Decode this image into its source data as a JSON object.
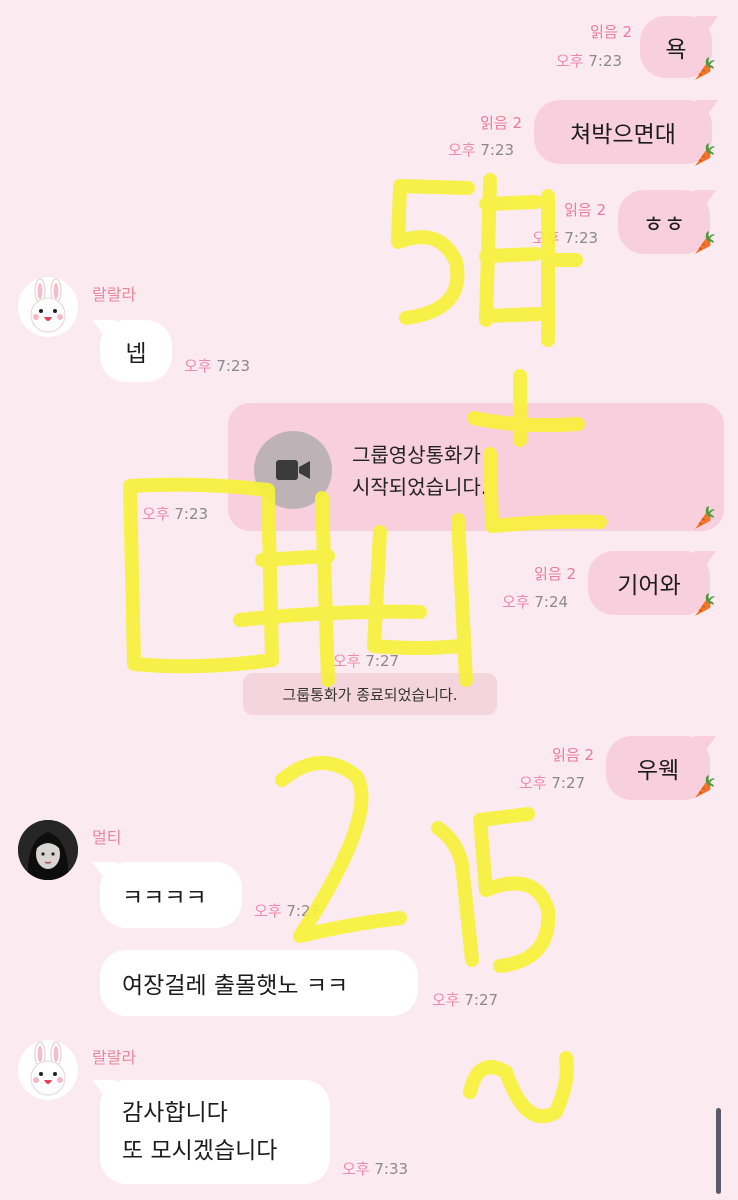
{
  "messages": {
    "m1": {
      "text": "욕",
      "read": "읽음 2",
      "ampm": "오후",
      "time": "7:23"
    },
    "m2": {
      "text": "쳐박으면대",
      "read": "읽음 2",
      "ampm": "오후",
      "time": "7:23"
    },
    "m3": {
      "text": "ㅎㅎ",
      "read": "읽음 2",
      "ampm": "오후",
      "time": "7:23"
    },
    "m4": {
      "sender": "랄랄라",
      "text": "넵",
      "ampm": "오후",
      "time": "7:23"
    },
    "m5": {
      "line1": "그룹영상통화가",
      "line2": "시작되었습니다.",
      "ampm": "오후",
      "time": "7:23"
    },
    "m6": {
      "text": "기어와",
      "read": "읽음 2",
      "ampm": "오후",
      "time": "7:24"
    },
    "m7": {
      "ampm": "오후",
      "time": "7:27",
      "text": "그룹통화가 종료되었습니다."
    },
    "m8": {
      "text": "우웩",
      "read": "읽음 2",
      "ampm": "오후",
      "time": "7:27"
    },
    "m9": {
      "sender": "멀티",
      "text": "ㅋㅋㅋㅋ",
      "ampm": "오후",
      "time": "7:27"
    },
    "m10": {
      "text": "여장걸레 출몰햇노 ㅋㅋ",
      "ampm": "오후",
      "time": "7:27"
    },
    "m11": {
      "sender": "랄랄라",
      "line1": "감사합니다",
      "line2": "또 모시겠습니다",
      "ampm": "오후",
      "time": "7:33"
    }
  },
  "overlay": {
    "description_color": "#f7f13a",
    "handwriting": [
      "5탑",
      "ㄷ",
      "ㄴ",
      "멀티",
      "2",
      "15",
      "~"
    ]
  },
  "icons": {
    "carrot": "carrot-icon",
    "video": "video-camera-icon",
    "avatar_bunny": "bunny-avatar",
    "avatar_girl": "profile-photo"
  }
}
